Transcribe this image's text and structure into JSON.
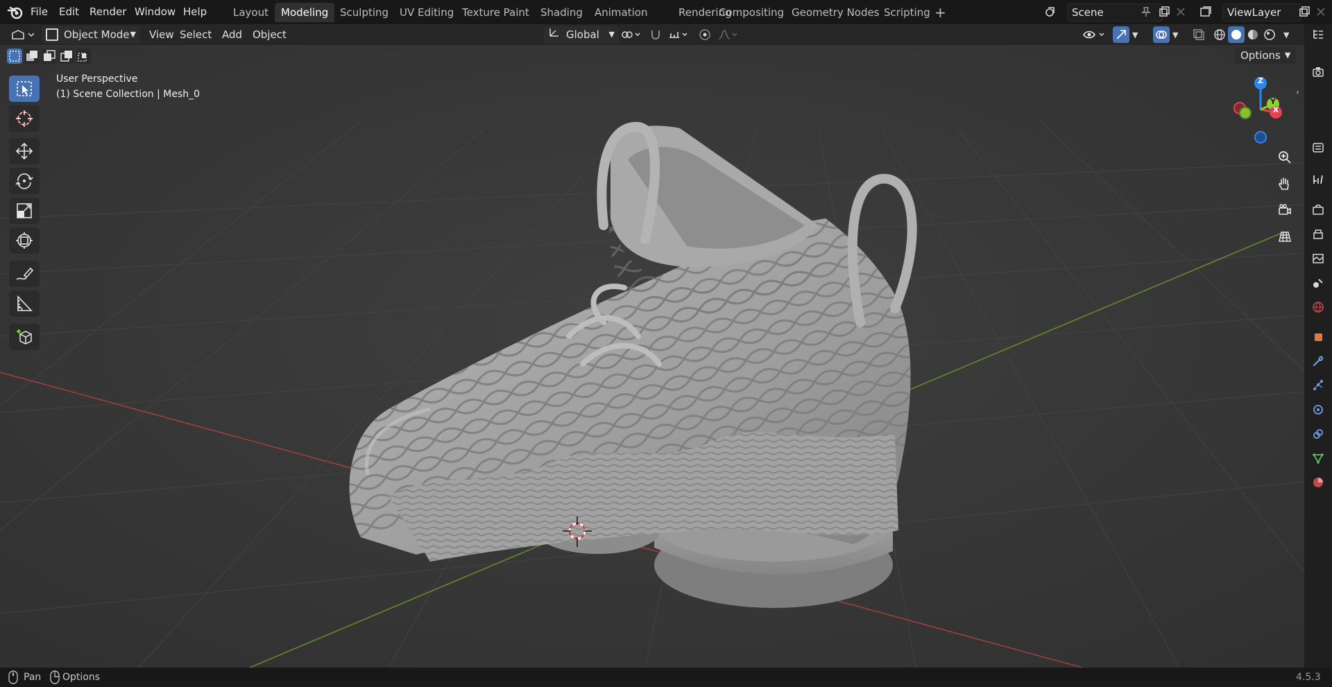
{
  "menu": {
    "file": "File",
    "edit": "Edit",
    "render": "Render",
    "window": "Window",
    "help": "Help"
  },
  "workspaces": [
    "Layout",
    "Modeling",
    "Sculpting",
    "UV Editing",
    "Texture Paint",
    "Shading",
    "Animation",
    "Rendering",
    "Compositing",
    "Geometry Nodes",
    "Scripting"
  ],
  "active_workspace": "Modeling",
  "add_workspace": "+",
  "scene": {
    "name": "Scene"
  },
  "view_layer": {
    "name": "ViewLayer"
  },
  "header": {
    "mode": "Object Mode",
    "view": "View",
    "select": "Select",
    "add": "Add",
    "object": "Object",
    "transform_orientation": "Global",
    "options": "Options"
  },
  "viewport": {
    "perspective": "User Perspective",
    "collection_info": "(1) Scene Collection | Mesh_0",
    "gizmo_axes": {
      "x": "X",
      "y": "Y",
      "z": "Z"
    }
  },
  "status": {
    "pan": "Pan",
    "options": "Options",
    "version": "4.5.3"
  },
  "colors": {
    "accent": "#4772b3",
    "axis_x": "#e8414f",
    "axis_y": "#8bd12c",
    "axis_z": "#2f86ea",
    "viewport_bg": "#393939",
    "x_line": "#b0403f",
    "y_line": "#6a9a2a"
  }
}
